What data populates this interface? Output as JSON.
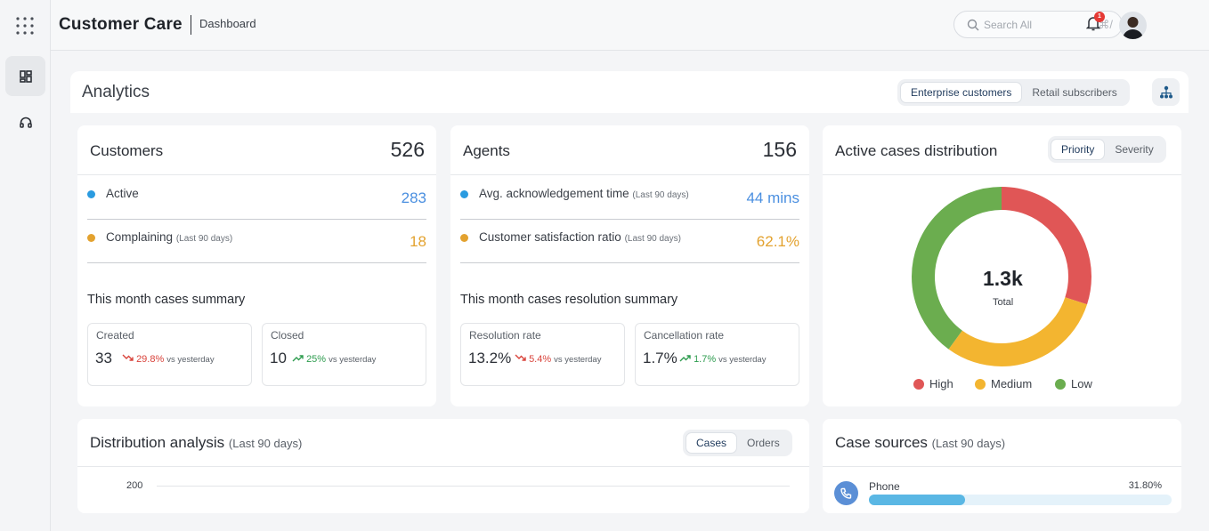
{
  "header": {
    "app_title": "Customer Care",
    "breadcrumb": "Dashboard",
    "search_placeholder": "Search All",
    "search_shortcut": "⌘/",
    "notification_count": "1"
  },
  "sidebar": {
    "items": [
      {
        "icon": "grid-dashboard-icon",
        "active": true
      },
      {
        "icon": "headset-icon",
        "active": false
      }
    ]
  },
  "analytics": {
    "title": "Analytics",
    "toggle": [
      "Enterprise customers",
      "Retail subscribers"
    ],
    "selected": "Enterprise customers"
  },
  "customers": {
    "title": "Customers",
    "total": "526",
    "active_label": "Active",
    "active_value": "283",
    "complaining_label": "Complaining",
    "complaining_note": "(Last 90 days)",
    "complaining_value": "18",
    "summary_title": "This month cases summary",
    "created": {
      "label": "Created",
      "value": "33",
      "delta": "29.8%",
      "vs": "vs yesterday",
      "direction": "down"
    },
    "closed": {
      "label": "Closed",
      "value": "10",
      "delta": "25%",
      "vs": "vs yesterday",
      "direction": "up"
    }
  },
  "agents": {
    "title": "Agents",
    "total": "156",
    "ack_label": "Avg. acknowledgement time",
    "ack_note": "(Last 90 days)",
    "ack_value": "44 mins",
    "csat_label": "Customer satisfaction ratio",
    "csat_note": "(Last 90 days)",
    "csat_value": "62.1%",
    "summary_title": "This month cases resolution summary",
    "resolution": {
      "label": "Resolution rate",
      "value": "13.2%",
      "delta": "5.4%",
      "vs": "vs yesterday",
      "direction": "down"
    },
    "cancellation": {
      "label": "Cancellation rate",
      "value": "1.7%",
      "delta": "1.7%",
      "vs": "vs yesterday",
      "direction": "up"
    }
  },
  "distribution": {
    "title": "Active cases distribution",
    "toggle": [
      "Priority",
      "Severity"
    ],
    "selected": "Priority",
    "total_value": "1.3k",
    "total_label": "Total",
    "legend": [
      "High",
      "Medium",
      "Low"
    ],
    "colors": {
      "High": "#e05656",
      "Medium": "#f3b530",
      "Low": "#6bad4f"
    },
    "shares": {
      "High": 0.3,
      "Medium": 0.3,
      "Low": 0.4
    }
  },
  "distribution_analysis": {
    "title": "Distribution analysis",
    "note": "(Last 90 days)",
    "toggle": [
      "Cases",
      "Orders"
    ],
    "selected": "Cases",
    "y_tick": "200"
  },
  "case_sources": {
    "title": "Case sources",
    "note": "(Last 90 days)",
    "items": [
      {
        "label": "Phone",
        "value": "31.80%",
        "fraction": 0.318,
        "icon": "phone-icon"
      }
    ]
  },
  "colors": {
    "blue": "#2a9be0",
    "amber": "#e3a22f",
    "blue_value": "#4a8fe0",
    "amber_value": "#e3a22f"
  }
}
